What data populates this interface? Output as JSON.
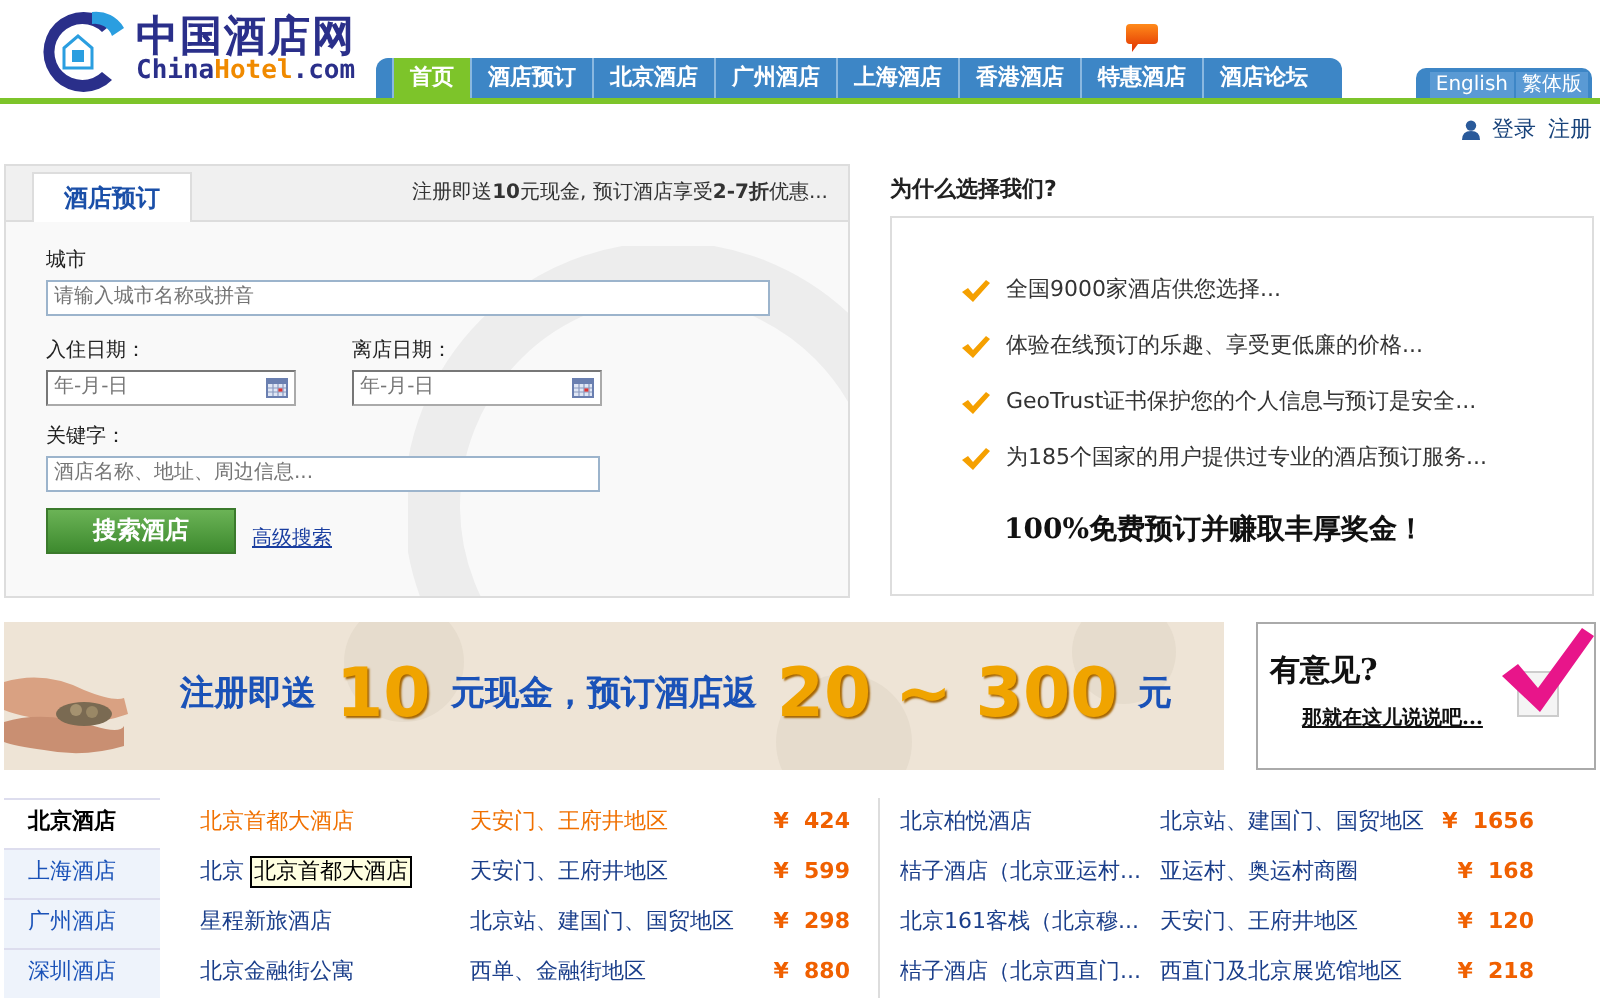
{
  "logo": {
    "title": "中国酒店网",
    "domain": [
      "China",
      "Hotel",
      ".com"
    ]
  },
  "nav": [
    {
      "label": "首页",
      "selected": true,
      "flag": false
    },
    {
      "label": "酒店预订",
      "selected": false,
      "flag": false
    },
    {
      "label": "北京酒店",
      "selected": false,
      "flag": false
    },
    {
      "label": "广州酒店",
      "selected": false,
      "flag": false
    },
    {
      "label": "上海酒店",
      "selected": false,
      "flag": false
    },
    {
      "label": "香港酒店",
      "selected": false,
      "flag": false
    },
    {
      "label": "特惠酒店",
      "selected": false,
      "flag": true
    },
    {
      "label": "酒店论坛",
      "selected": false,
      "flag": false
    }
  ],
  "languages": [
    "English",
    "繁体版"
  ],
  "account": {
    "login": "登录",
    "register": "注册"
  },
  "search": {
    "tab": "酒店预订",
    "promo": "注册即送**10**元现金, 预订酒店享受**2-7折**优惠...",
    "city": {
      "label": "城市",
      "placeholder": "请输入城市名称或拼音"
    },
    "checkin": {
      "label": "入住日期：",
      "placeholder": "年-月-日"
    },
    "checkout": {
      "label": "离店日期：",
      "placeholder": "年-月-日"
    },
    "keyword": {
      "label": "关键字：",
      "placeholder": "酒店名称、地址、周边信息..."
    },
    "button": "搜索酒店",
    "advanced": "高级搜索"
  },
  "why": {
    "title": "为什么选择我们?",
    "items": [
      "全国9000家酒店供您选择...",
      "体验在线预订的乐趣、享受更低廉的价格...",
      "GeoTrust证书保护您的个人信息与预订是安全...",
      "为185个国家的用户提供过专业的酒店预订服务..."
    ],
    "slogan": "100%免费预订并赚取丰厚奖金！"
  },
  "banner": {
    "parts": [
      {
        "text": "注册即送",
        "kind": "word"
      },
      {
        "text": "10",
        "kind": "number"
      },
      {
        "text": "元现金，预订酒店返",
        "kind": "word"
      },
      {
        "text": "20 ~ 300",
        "kind": "number"
      },
      {
        "text": "元",
        "kind": "word"
      }
    ]
  },
  "feedback": {
    "title": "有意见?",
    "link": "那就在这儿说说吧..."
  },
  "cities": [
    {
      "label": "北京酒店",
      "selected": true
    },
    {
      "label": "上海酒店",
      "selected": false
    },
    {
      "label": "广州酒店",
      "selected": false
    },
    {
      "label": "深圳酒店",
      "selected": false
    }
  ],
  "hotels_left": [
    {
      "name": "北京首都大酒店",
      "area": "天安门、王府井地区",
      "price": "¥  424",
      "highlighted": true
    },
    {
      "name": "北京",
      "area": "天安门、王府井地区",
      "price": "¥  599",
      "highlighted": false
    },
    {
      "name": "星程新旅酒店",
      "area": "北京站、建国门、国贸地区",
      "price": "¥  298",
      "highlighted": false
    },
    {
      "name": "北京金融街公寓",
      "area": "西单、金融街地区",
      "price": "¥  880",
      "highlighted": false
    }
  ],
  "tooltip": "北京首都大酒店",
  "hotels_right": [
    {
      "name": "北京柏悦酒店",
      "area": "北京站、建国门、国贸地区",
      "price": "¥  1656",
      "highlighted": false
    },
    {
      "name": "桔子酒店（北京亚运村...",
      "area": "亚运村、奥运村商圈",
      "price": "¥  168",
      "highlighted": false
    },
    {
      "name": "北京161客栈（北京穆...",
      "area": "天安门、王府井地区",
      "price": "¥  120",
      "highlighted": false
    },
    {
      "name": "桔子酒店（北京西直门...",
      "area": "西直门及北京展览馆地区",
      "price": "¥  218",
      "highlighted": false
    }
  ]
}
